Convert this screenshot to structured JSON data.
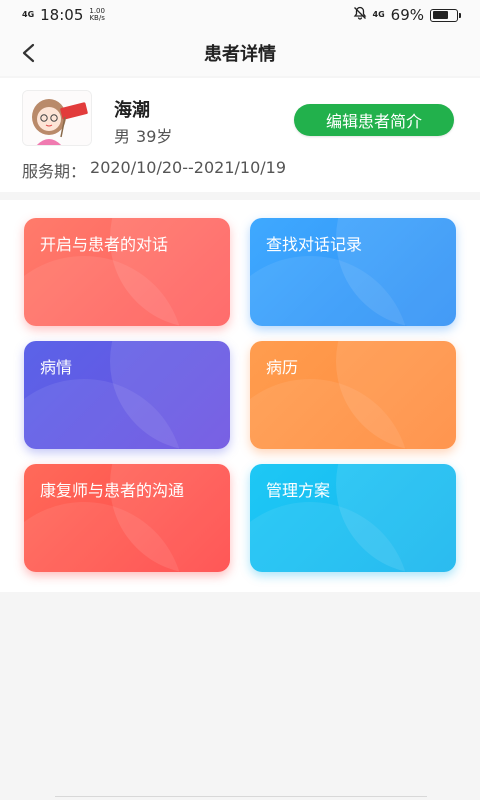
{
  "status_bar": {
    "network": "4G",
    "time": "18:05",
    "speed_value": "1.00",
    "speed_unit": "KB/s",
    "right_network": "4G",
    "battery": "69%",
    "battery_level": 0.69
  },
  "nav": {
    "title": "患者详情",
    "back_icon": "chevron-left-icon"
  },
  "patient": {
    "name": "海潮",
    "gender": "男",
    "age": "39岁",
    "edit_label": "编辑患者简介",
    "service_label": "服务期：",
    "service_period": "2020/10/20--2021/10/19",
    "avatar_icon": "cartoon-avatar",
    "accent_color": "#22b14c"
  },
  "tiles": [
    {
      "label": "开启与患者的对话",
      "color": "#ff6b60"
    },
    {
      "label": "查找对话记录",
      "color": "#3a9dfb"
    },
    {
      "label": "病情",
      "color": "#5f5be6"
    },
    {
      "label": "病历",
      "color": "#ff9447"
    },
    {
      "label": "康复师与患者的沟通",
      "color": "#ff5550"
    },
    {
      "label": "管理方案",
      "color": "#19bef2"
    }
  ]
}
